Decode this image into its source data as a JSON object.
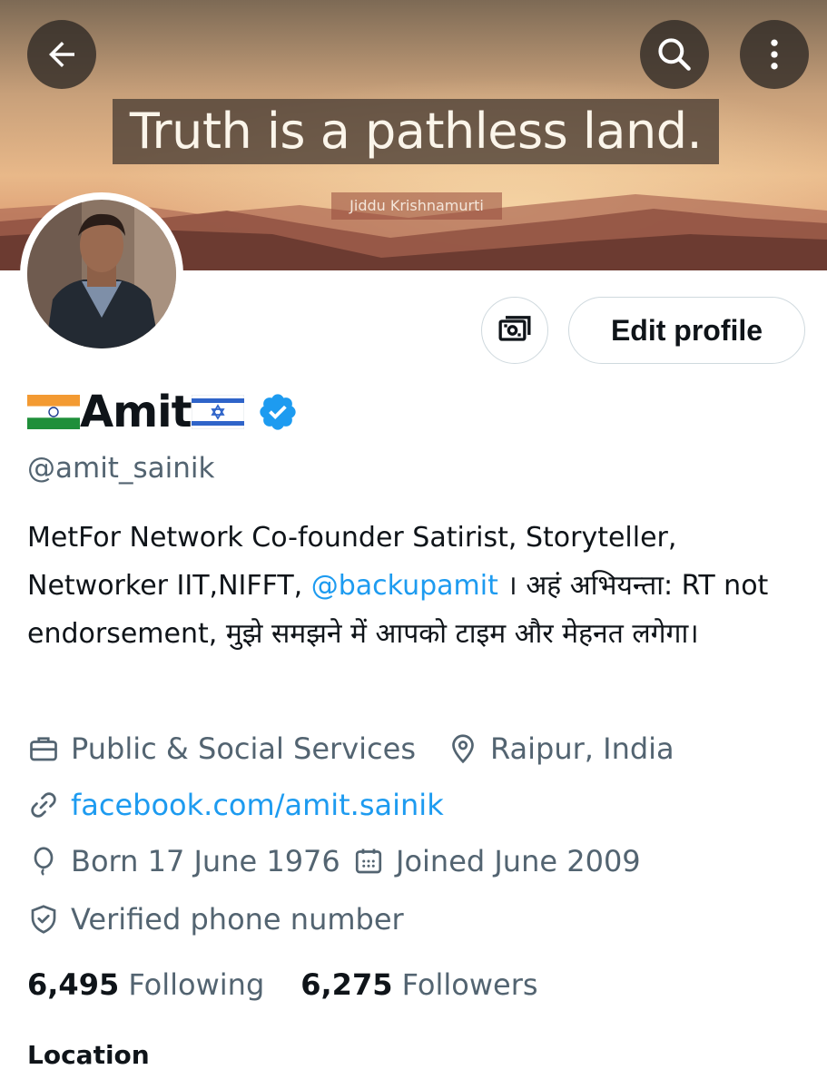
{
  "header": {
    "back_icon": "arrow-left-icon",
    "search_icon": "search-icon",
    "more_icon": "more-vertical-icon",
    "banner_quote": "Truth is a pathless land.",
    "banner_author": "Jiddu Krishnamurti"
  },
  "profile": {
    "name": "Amit",
    "flag_left": "🇮🇳",
    "flag_right": "🇮🇱",
    "verified_icon": "verified-badge-icon",
    "handle": "@amit_sainik",
    "edit_profile_label": "Edit profile",
    "bio_part1": "MetFor Network Co-founder Satirist, Storyteller, Networker IIT,NIFFT, ",
    "bio_mention": "@backupamit",
    "bio_part2": " । अहं अभियन्ता: RT not endorsement, मुझे समझने में आपको टाइम और मेहनत लगेगा।",
    "category": "Public & Social Services",
    "location": "Raipur, India",
    "website": "facebook.com/amit.sainik",
    "birthday": "Born 17 June 1976",
    "joined": "Joined June 2009",
    "verified_phone": "Verified phone number"
  },
  "stats": {
    "following_count": "6,495",
    "following_label": "Following",
    "followers_count": "6,275",
    "followers_label": "Followers"
  },
  "section": {
    "location_title": "Location"
  },
  "colors": {
    "link": "#1d9bf0",
    "secondary_text": "#536471",
    "verified": "#1d9bf0"
  }
}
